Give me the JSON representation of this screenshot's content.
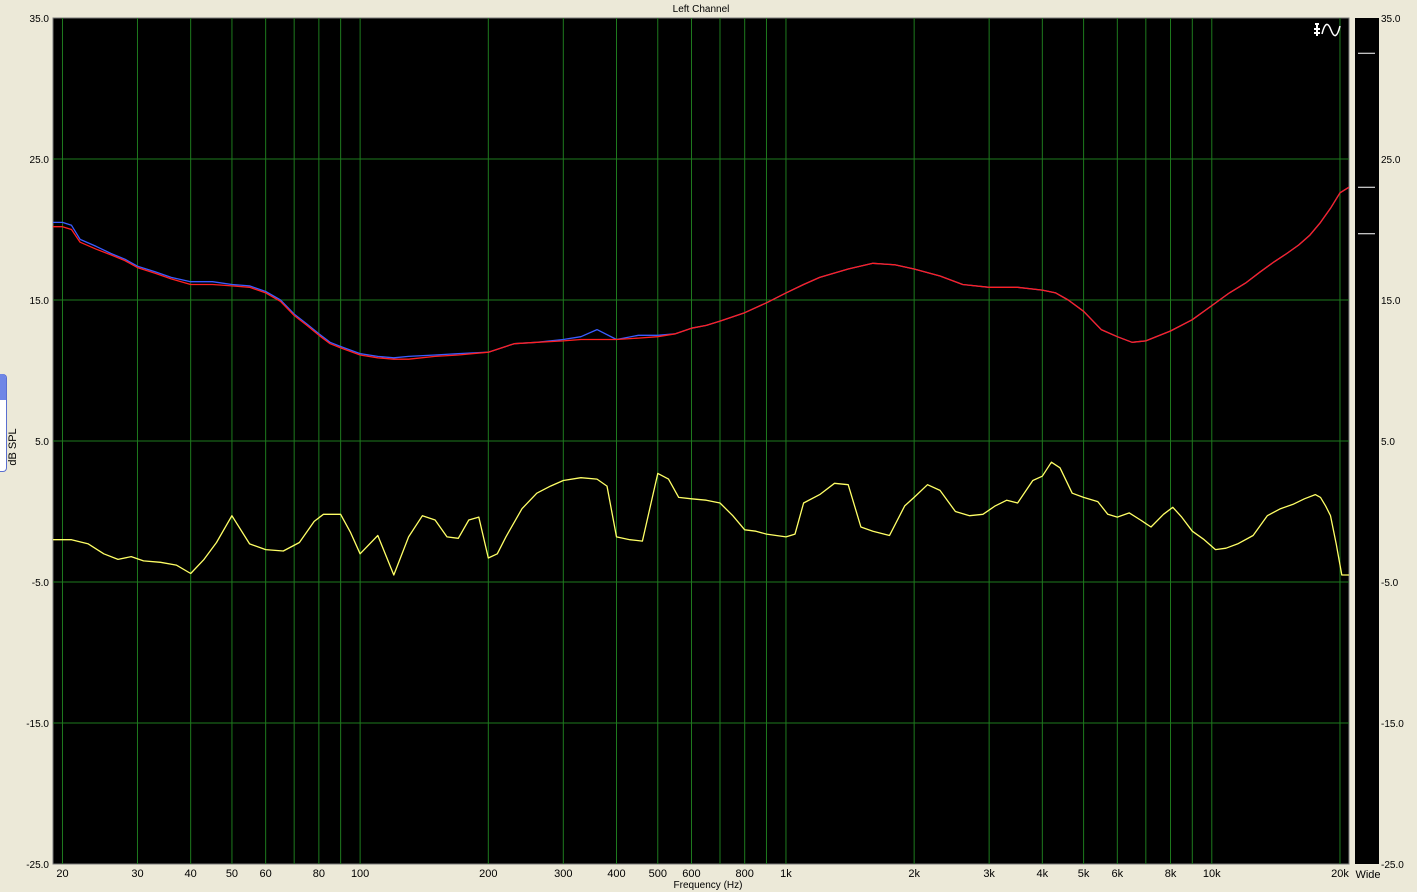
{
  "window": {
    "title": "Left Channel",
    "bg_color": "#ece9d8",
    "plot_bg_color": "#000000",
    "grid_color": "#1e7a1e"
  },
  "legend_icon": {
    "name": "wave-settings-icon",
    "glyph": "∿"
  },
  "right_panel": {
    "mode_label": "Wide"
  },
  "chart_data": {
    "type": "line",
    "title": "Left Channel",
    "xlabel": "Frequency (Hz)",
    "ylabel": "dB SPL",
    "xscale": "log",
    "xlim": [
      19,
      21000
    ],
    "ylim": [
      -25,
      35
    ],
    "y_ticks": [
      35,
      25,
      15,
      5,
      -5,
      -15,
      -25
    ],
    "y_tick_labels": [
      "35.0",
      "25.0",
      "15.0",
      "5.0",
      "-5.0",
      "-15.0",
      "-25.0"
    ],
    "x_major_ticks": [
      20,
      30,
      40,
      50,
      60,
      80,
      100,
      200,
      300,
      400,
      500,
      600,
      800,
      1000,
      2000,
      3000,
      4000,
      5000,
      6000,
      8000,
      10000,
      20000
    ],
    "x_tick_labels": [
      "20",
      "30",
      "40",
      "50",
      "60",
      "80",
      "100",
      "200",
      "300",
      "400",
      "500",
      "600",
      "800",
      "1k",
      "2k",
      "3k",
      "4k",
      "5k",
      "6k",
      "8k",
      "10k",
      "20k"
    ],
    "x_minor_ticks": [
      70,
      90,
      700,
      900,
      7000,
      9000
    ],
    "grid": true,
    "series": [
      {
        "color": "#3a5cff",
        "points": [
          [
            19,
            20.5
          ],
          [
            20,
            20.5
          ],
          [
            21,
            20.3
          ],
          [
            22,
            19.3
          ],
          [
            24,
            18.8
          ],
          [
            26,
            18.3
          ],
          [
            28,
            17.9
          ],
          [
            30,
            17.4
          ],
          [
            33,
            17.0
          ],
          [
            36,
            16.6
          ],
          [
            40,
            16.3
          ],
          [
            45,
            16.3
          ],
          [
            50,
            16.1
          ],
          [
            55,
            16.0
          ],
          [
            60,
            15.6
          ],
          [
            65,
            15.0
          ],
          [
            70,
            14.0
          ],
          [
            75,
            13.3
          ],
          [
            80,
            12.6
          ],
          [
            85,
            12.0
          ],
          [
            90,
            11.7
          ],
          [
            100,
            11.2
          ],
          [
            110,
            11.0
          ],
          [
            120,
            10.9
          ],
          [
            130,
            11.0
          ],
          [
            150,
            11.1
          ],
          [
            170,
            11.2
          ],
          [
            200,
            11.3
          ],
          [
            230,
            11.9
          ],
          [
            260,
            12.0
          ],
          [
            300,
            12.2
          ],
          [
            330,
            12.4
          ],
          [
            360,
            12.9
          ],
          [
            400,
            12.2
          ],
          [
            450,
            12.5
          ],
          [
            500,
            12.5
          ],
          [
            550,
            12.6
          ],
          [
            600,
            13.0
          ],
          [
            650,
            13.2
          ],
          [
            700,
            13.5
          ],
          [
            800,
            14.1
          ],
          [
            900,
            14.8
          ],
          [
            1000,
            15.5
          ],
          [
            1100,
            16.1
          ],
          [
            1200,
            16.6
          ],
          [
            1400,
            17.2
          ],
          [
            1600,
            17.6
          ],
          [
            1800,
            17.5
          ],
          [
            2000,
            17.2
          ],
          [
            2300,
            16.7
          ],
          [
            2600,
            16.1
          ],
          [
            3000,
            15.9
          ],
          [
            3500,
            15.9
          ],
          [
            4000,
            15.7
          ],
          [
            4300,
            15.5
          ],
          [
            4600,
            15.0
          ],
          [
            5000,
            14.2
          ],
          [
            5500,
            12.9
          ],
          [
            6000,
            12.4
          ],
          [
            6500,
            12.0
          ],
          [
            7000,
            12.1
          ],
          [
            8000,
            12.8
          ],
          [
            9000,
            13.6
          ],
          [
            10000,
            14.6
          ],
          [
            11000,
            15.5
          ],
          [
            12000,
            16.2
          ],
          [
            13000,
            17.0
          ],
          [
            14000,
            17.7
          ],
          [
            15000,
            18.3
          ],
          [
            16000,
            18.9
          ],
          [
            17000,
            19.6
          ],
          [
            18000,
            20.5
          ],
          [
            19000,
            21.5
          ],
          [
            20000,
            22.6
          ],
          [
            21000,
            23.0
          ]
        ]
      },
      {
        "color": "#ff2020",
        "points": [
          [
            19,
            20.2
          ],
          [
            20,
            20.2
          ],
          [
            21,
            20.0
          ],
          [
            22,
            19.1
          ],
          [
            24,
            18.6
          ],
          [
            26,
            18.2
          ],
          [
            28,
            17.8
          ],
          [
            30,
            17.3
          ],
          [
            33,
            16.9
          ],
          [
            36,
            16.5
          ],
          [
            40,
            16.1
          ],
          [
            45,
            16.1
          ],
          [
            50,
            16.0
          ],
          [
            55,
            15.9
          ],
          [
            60,
            15.5
          ],
          [
            65,
            14.9
          ],
          [
            70,
            13.9
          ],
          [
            75,
            13.2
          ],
          [
            80,
            12.5
          ],
          [
            85,
            11.9
          ],
          [
            90,
            11.6
          ],
          [
            100,
            11.1
          ],
          [
            110,
            10.9
          ],
          [
            120,
            10.8
          ],
          [
            130,
            10.8
          ],
          [
            150,
            11.0
          ],
          [
            170,
            11.1
          ],
          [
            200,
            11.3
          ],
          [
            230,
            11.9
          ],
          [
            260,
            12.0
          ],
          [
            300,
            12.1
          ],
          [
            330,
            12.2
          ],
          [
            360,
            12.2
          ],
          [
            400,
            12.2
          ],
          [
            450,
            12.3
          ],
          [
            500,
            12.4
          ],
          [
            550,
            12.6
          ],
          [
            600,
            13.0
          ],
          [
            650,
            13.2
          ],
          [
            700,
            13.5
          ],
          [
            800,
            14.1
          ],
          [
            900,
            14.8
          ],
          [
            1000,
            15.5
          ],
          [
            1100,
            16.1
          ],
          [
            1200,
            16.6
          ],
          [
            1400,
            17.2
          ],
          [
            1600,
            17.6
          ],
          [
            1800,
            17.5
          ],
          [
            2000,
            17.2
          ],
          [
            2300,
            16.7
          ],
          [
            2600,
            16.1
          ],
          [
            3000,
            15.9
          ],
          [
            3500,
            15.9
          ],
          [
            4000,
            15.7
          ],
          [
            4300,
            15.5
          ],
          [
            4600,
            15.0
          ],
          [
            5000,
            14.2
          ],
          [
            5500,
            12.9
          ],
          [
            6000,
            12.4
          ],
          [
            6500,
            12.0
          ],
          [
            7000,
            12.1
          ],
          [
            8000,
            12.8
          ],
          [
            9000,
            13.6
          ],
          [
            10000,
            14.6
          ],
          [
            11000,
            15.5
          ],
          [
            12000,
            16.2
          ],
          [
            13000,
            17.0
          ],
          [
            14000,
            17.7
          ],
          [
            15000,
            18.3
          ],
          [
            16000,
            18.9
          ],
          [
            17000,
            19.6
          ],
          [
            18000,
            20.5
          ],
          [
            19000,
            21.5
          ],
          [
            20000,
            22.6
          ],
          [
            21000,
            23.0
          ]
        ]
      },
      {
        "color": "#ffff66",
        "points": [
          [
            19,
            -2.0
          ],
          [
            21,
            -2.0
          ],
          [
            23,
            -2.3
          ],
          [
            25,
            -3.0
          ],
          [
            27,
            -3.4
          ],
          [
            29,
            -3.2
          ],
          [
            31,
            -3.5
          ],
          [
            34,
            -3.6
          ],
          [
            37,
            -3.8
          ],
          [
            40,
            -4.4
          ],
          [
            43,
            -3.4
          ],
          [
            46,
            -2.2
          ],
          [
            50,
            -0.3
          ],
          [
            55,
            -2.3
          ],
          [
            60,
            -2.7
          ],
          [
            66,
            -2.8
          ],
          [
            72,
            -2.2
          ],
          [
            78,
            -0.7
          ],
          [
            82,
            -0.2
          ],
          [
            90,
            -0.2
          ],
          [
            95,
            -1.5
          ],
          [
            100,
            -3.0
          ],
          [
            110,
            -1.7
          ],
          [
            120,
            -4.5
          ],
          [
            130,
            -1.8
          ],
          [
            140,
            -0.3
          ],
          [
            150,
            -0.6
          ],
          [
            160,
            -1.8
          ],
          [
            170,
            -1.9
          ],
          [
            180,
            -0.6
          ],
          [
            190,
            -0.4
          ],
          [
            200,
            -3.3
          ],
          [
            210,
            -3.0
          ],
          [
            220,
            -1.8
          ],
          [
            240,
            0.2
          ],
          [
            260,
            1.3
          ],
          [
            280,
            1.8
          ],
          [
            300,
            2.2
          ],
          [
            330,
            2.4
          ],
          [
            360,
            2.3
          ],
          [
            380,
            1.8
          ],
          [
            400,
            -1.8
          ],
          [
            430,
            -2.0
          ],
          [
            460,
            -2.1
          ],
          [
            500,
            2.7
          ],
          [
            530,
            2.3
          ],
          [
            560,
            1.0
          ],
          [
            600,
            0.9
          ],
          [
            650,
            0.8
          ],
          [
            700,
            0.6
          ],
          [
            750,
            -0.3
          ],
          [
            800,
            -1.3
          ],
          [
            850,
            -1.4
          ],
          [
            900,
            -1.6
          ],
          [
            1000,
            -1.8
          ],
          [
            1050,
            -1.6
          ],
          [
            1100,
            0.6
          ],
          [
            1200,
            1.2
          ],
          [
            1300,
            2.0
          ],
          [
            1400,
            1.9
          ],
          [
            1500,
            -1.1
          ],
          [
            1600,
            -1.4
          ],
          [
            1750,
            -1.7
          ],
          [
            1900,
            0.4
          ],
          [
            2000,
            1.0
          ],
          [
            2150,
            1.9
          ],
          [
            2300,
            1.5
          ],
          [
            2500,
            0.0
          ],
          [
            2700,
            -0.3
          ],
          [
            2900,
            -0.2
          ],
          [
            3100,
            0.4
          ],
          [
            3300,
            0.8
          ],
          [
            3500,
            0.6
          ],
          [
            3800,
            2.2
          ],
          [
            4000,
            2.5
          ],
          [
            4200,
            3.5
          ],
          [
            4400,
            3.1
          ],
          [
            4700,
            1.3
          ],
          [
            5000,
            1.0
          ],
          [
            5400,
            0.7
          ],
          [
            5700,
            -0.2
          ],
          [
            6000,
            -0.4
          ],
          [
            6400,
            -0.1
          ],
          [
            6800,
            -0.6
          ],
          [
            7200,
            -1.1
          ],
          [
            7700,
            -0.2
          ],
          [
            8100,
            0.3
          ],
          [
            8500,
            -0.4
          ],
          [
            9000,
            -1.4
          ],
          [
            9600,
            -2.0
          ],
          [
            10200,
            -2.7
          ],
          [
            10800,
            -2.6
          ],
          [
            11500,
            -2.3
          ],
          [
            12500,
            -1.7
          ],
          [
            13500,
            -0.3
          ],
          [
            14500,
            0.2
          ],
          [
            15500,
            0.5
          ],
          [
            16500,
            0.9
          ],
          [
            17500,
            1.2
          ],
          [
            18000,
            1.0
          ],
          [
            18500,
            0.4
          ],
          [
            19000,
            -0.3
          ],
          [
            19600,
            -2.3
          ],
          [
            20200,
            -4.5
          ],
          [
            21000,
            -4.5
          ]
        ]
      }
    ]
  }
}
